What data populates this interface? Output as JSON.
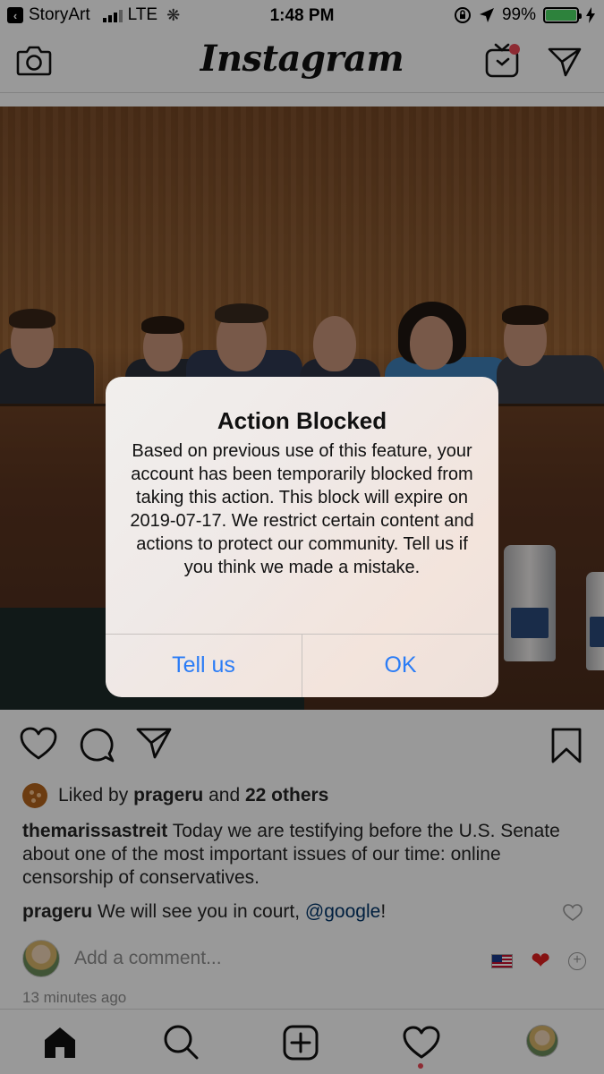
{
  "status_bar": {
    "back_app": "StoryArt",
    "network": "LTE",
    "time": "1:48 PM",
    "battery_percent": "99%",
    "battery_level": 0.99
  },
  "header": {
    "logo": "Instagram"
  },
  "post": {
    "likes": {
      "prefix": "Liked by",
      "user": "prageru",
      "conjunction": "and",
      "others": "22 others"
    },
    "caption": {
      "username": "themarissastreit",
      "text": "Today we are testifying before the U.S. Senate about one of the most important issues of our time: online censorship of conservatives."
    },
    "comment": {
      "username": "prageru",
      "text": "We will see you in court,",
      "mention": "@google",
      "suffix": "!"
    },
    "add_comment_placeholder": "Add a comment...",
    "timestamp": "13 minutes ago"
  },
  "alert": {
    "title": "Action Blocked",
    "message": "Based on previous use of this feature, your account has been temporarily blocked from taking this action. This block will expire on 2019-07-17. We restrict certain content and actions to protect our community. Tell us if you think we made a mistake.",
    "button_left": "Tell us",
    "button_right": "OK",
    "button_color": "#2a7cf6"
  },
  "icons": {
    "header": [
      "camera-icon",
      "igtv-icon",
      "direct-message-icon"
    ],
    "actions": [
      "like-heart-icon",
      "comment-bubble-icon",
      "share-icon",
      "bookmark-icon"
    ],
    "tabs": [
      "home-icon",
      "search-icon",
      "new-post-icon",
      "activity-heart-icon",
      "profile-avatar"
    ]
  },
  "colors": {
    "notification_dot": "#ed4956",
    "mention": "#003569",
    "secondary_text": "#8e8e8e"
  }
}
